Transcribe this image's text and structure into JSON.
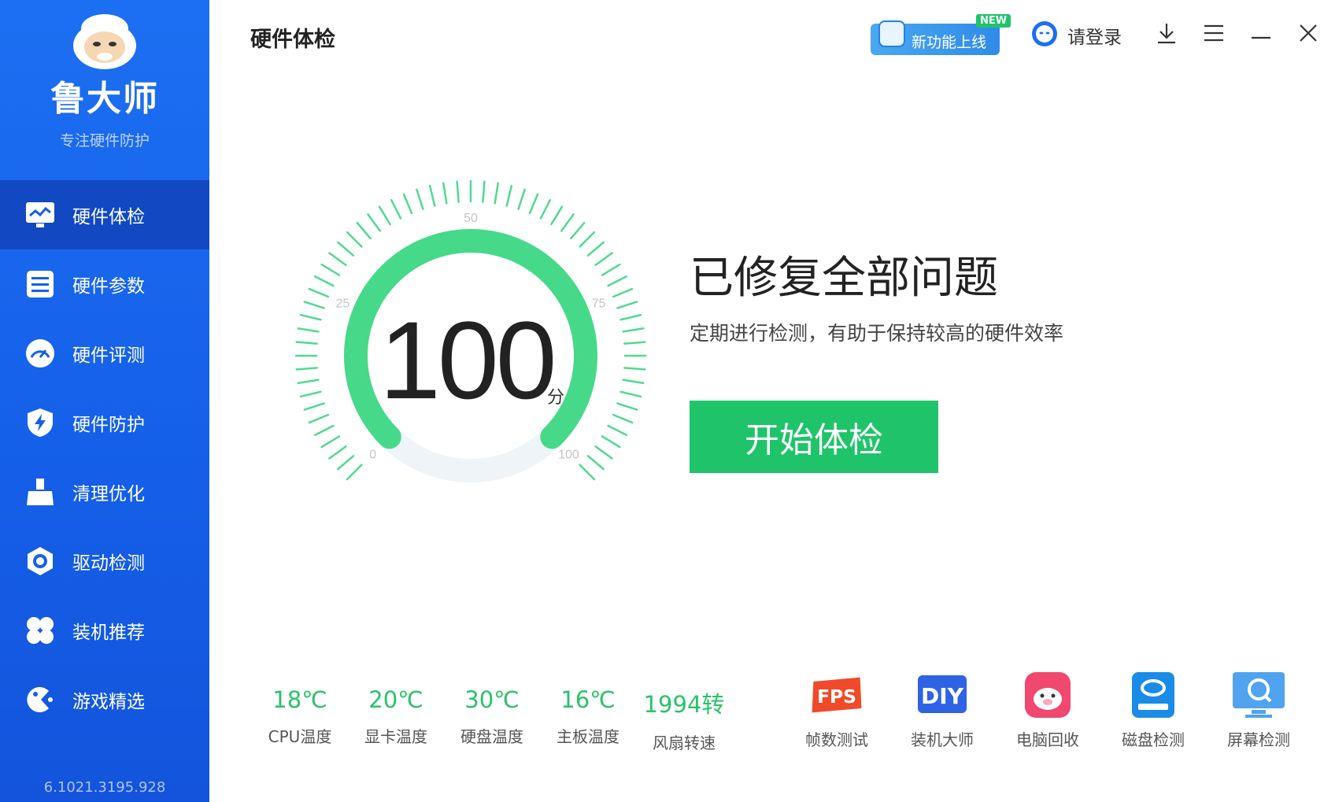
{
  "sidebar": {
    "brand": "鲁大师",
    "slogan": "专注硬件防护",
    "version": "6.1021.3195.928",
    "items": [
      {
        "label": "硬件体检"
      },
      {
        "label": "硬件参数"
      },
      {
        "label": "硬件评测"
      },
      {
        "label": "硬件防护"
      },
      {
        "label": "清理优化"
      },
      {
        "label": "驱动检测"
      },
      {
        "label": "装机推荐"
      },
      {
        "label": "游戏精选"
      }
    ]
  },
  "header": {
    "title": "硬件体检",
    "promo_text": "新功能上线",
    "promo_badge": "NEW",
    "login_label": "请登录"
  },
  "gauge": {
    "score": "100",
    "unit": "分",
    "ticks": [
      "0",
      "25",
      "50",
      "75",
      "100"
    ],
    "fill_fraction": 1.0
  },
  "status": {
    "title": "已修复全部问题",
    "subtitle": "定期进行检测，有助于保持较高的硬件效率",
    "button_label": "开始体检"
  },
  "stats": [
    {
      "value": "18℃",
      "label": "CPU温度"
    },
    {
      "value": "20℃",
      "label": "显卡温度"
    },
    {
      "value": "30℃",
      "label": "硬盘温度"
    },
    {
      "value": "16℃",
      "label": "主板温度"
    },
    {
      "value": "1994转",
      "label": "风扇转速"
    }
  ],
  "tools": [
    {
      "label": "帧数测试",
      "icon": "fps-icon"
    },
    {
      "label": "装机大师",
      "icon": "diy-icon"
    },
    {
      "label": "电脑回收",
      "icon": "recycle-pig-icon"
    },
    {
      "label": "磁盘检测",
      "icon": "disk-icon"
    },
    {
      "label": "屏幕检测",
      "icon": "screen-icon"
    }
  ],
  "colors": {
    "sidebar": "#1560e9",
    "sidebar_active": "#1249c2",
    "accent_green": "#1fc46a",
    "gauge_green": "#47d98a"
  }
}
